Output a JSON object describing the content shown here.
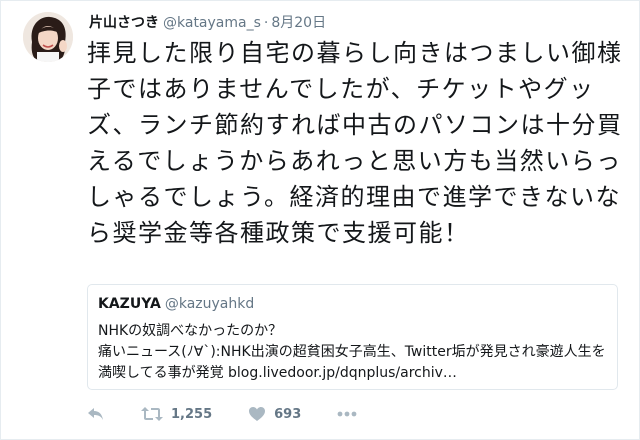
{
  "tweet": {
    "display_name": "片山さつき",
    "handle": "@katayama_s",
    "separator": "·",
    "date": "8月20日",
    "text": "拝見した限り自宅の暮らし向きはつましい御様子ではありませんでしたが、チケットやグッズ、ランチ節約すれば中古のパソコンは十分買えるでしょうからあれっと思い方も当然いらっしゃるでしょう。経済的理由で進学できないなら奨学金等各種政策で支援可能！"
  },
  "quoted_tweet": {
    "display_name": "KAZUYA",
    "handle": "@kazuyahkd",
    "text": "NHKの奴調べなかったのか？\n痛いニュース(ﾉ∀`):NHK出演の超貧困女子高生、Twitter垢が発見され豪遊人生を満喫してる事が発覚 blog.livedoor.jp/dqnplus/archiv…"
  },
  "actions": {
    "reply_icon": "reply-icon",
    "retweet_icon": "retweet-icon",
    "retweet_count": "1,255",
    "like_icon": "heart-icon",
    "like_count": "693",
    "more_icon": "more-dots-icon"
  },
  "colors": {
    "text": "#14171a",
    "secondary": "#657786",
    "border": "#e1e8ed"
  }
}
